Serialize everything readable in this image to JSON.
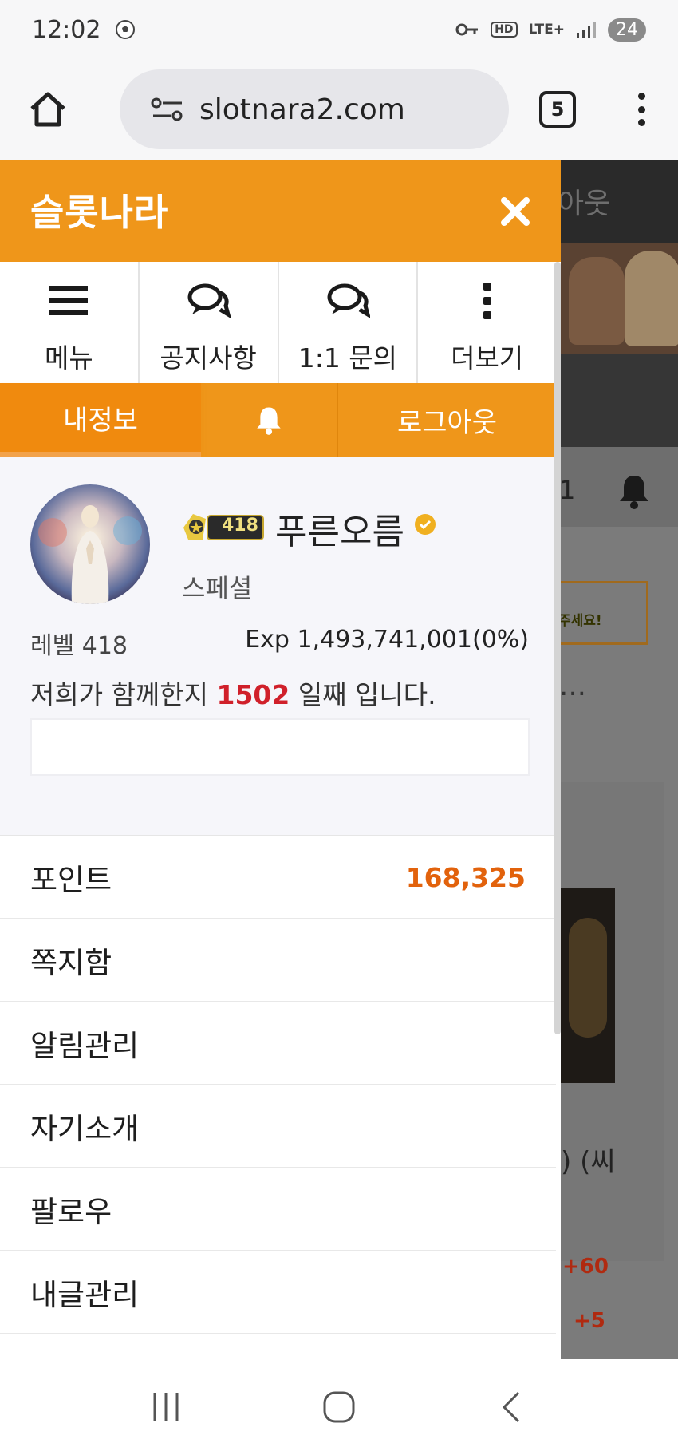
{
  "status_bar": {
    "time": "12:02",
    "network": "LTE+",
    "hd": "HD",
    "battery": "24"
  },
  "browser": {
    "url": "slotnara2.com",
    "tab_count": "5"
  },
  "drawer": {
    "title": "슬롯나라",
    "quick_menu": [
      {
        "label": "메뉴",
        "icon": "hamburger-icon"
      },
      {
        "label": "공지사항",
        "icon": "chat-bubbles-icon"
      },
      {
        "label": "1:1 문의",
        "icon": "chat-bubbles-icon"
      },
      {
        "label": "더보기",
        "icon": "more-vertical-icon"
      }
    ],
    "actions": {
      "my_info": "내정보",
      "logout": "로그아웃"
    },
    "profile": {
      "level_badge": "418",
      "name": "푸른오름",
      "grade": "스페셜",
      "level": "레벨 418",
      "exp": "Exp 1,493,741,001(0%)",
      "days_prefix": "저희가 함께한지 ",
      "days_count": "1502",
      "days_suffix": " 일째 입니다."
    },
    "menu": [
      {
        "label": "포인트",
        "value": "168,325"
      },
      {
        "label": "쪽지함"
      },
      {
        "label": "알림관리"
      },
      {
        "label": "자기소개"
      },
      {
        "label": "팔로우"
      },
      {
        "label": "내글관리"
      }
    ]
  },
  "background_page": {
    "header_text": "아웃",
    "digit": "1",
    "notice": "주세요!",
    "ellipsis": "…",
    "fragment": ") (씨",
    "points": [
      "+60",
      "+5"
    ]
  },
  "colors": {
    "accent": "#ef961a",
    "point_value": "#e2620c",
    "days_count": "#d0202a"
  }
}
